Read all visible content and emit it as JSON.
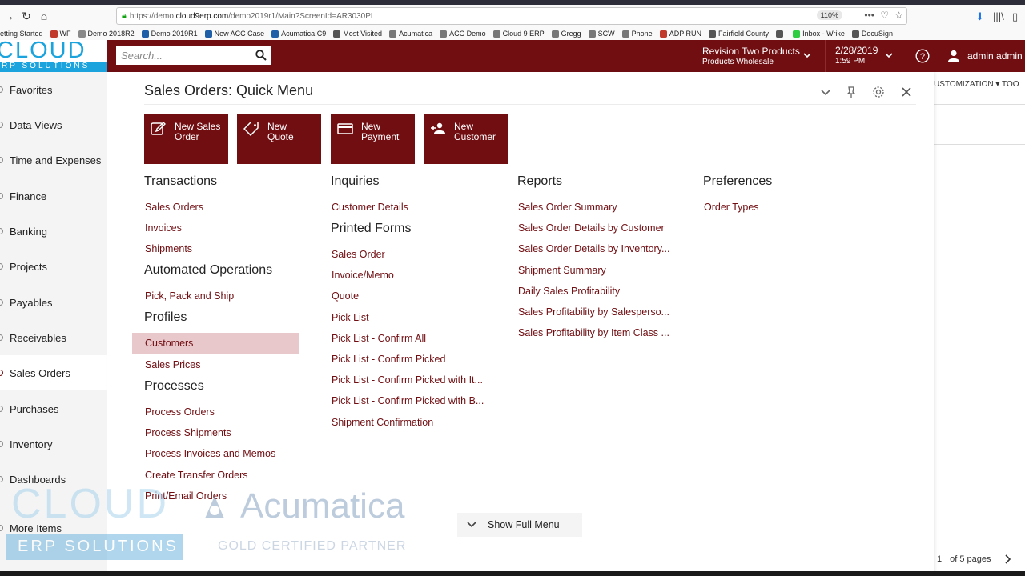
{
  "browser": {
    "url_prefix": "https://demo.",
    "url_domain": "cloud9erp.com",
    "url_path": "/demo2019r1/Main?ScreenId=AR3030PL",
    "zoom": "110%",
    "bookmarks": [
      {
        "label": "etting Started",
        "color": "#ffffff"
      },
      {
        "label": "WF",
        "color": "#c0392b"
      },
      {
        "label": "Demo 2018R2",
        "color": "#888888"
      },
      {
        "label": "Demo 2019R1",
        "color": "#1f5fa8"
      },
      {
        "label": "New ACC Case",
        "color": "#1f5fa8"
      },
      {
        "label": "Acumatica C9",
        "color": "#1f5fa8"
      },
      {
        "label": "Most Visited",
        "color": "#555555"
      },
      {
        "label": "Acumatica",
        "color": "#777777"
      },
      {
        "label": "ACC Demo",
        "color": "#777777"
      },
      {
        "label": "Cloud 9 ERP",
        "color": "#777777"
      },
      {
        "label": "Gregg",
        "color": "#777777"
      },
      {
        "label": "SCW",
        "color": "#777777"
      },
      {
        "label": "Phone",
        "color": "#777777"
      },
      {
        "label": "ADP RUN",
        "color": "#c0392b"
      },
      {
        "label": "Fairfield County",
        "color": "#555555"
      },
      {
        "label": "",
        "color": "#555555"
      },
      {
        "label": "Inbox - Wrike",
        "color": "#2ecc40"
      },
      {
        "label": "DocuSign",
        "color": "#555555"
      }
    ]
  },
  "header": {
    "logo_top": "CLOUD",
    "logo_bottom": "RP SOLUTIONS",
    "search_placeholder": "Search...",
    "branch_line1": "Revision Two Products",
    "branch_line2": "Products Wholesale",
    "date": "2/28/2019",
    "time": "1:59 PM",
    "user": "admin admin",
    "accent": "#700e12"
  },
  "sidebar": {
    "items": [
      "Favorites",
      "Data Views",
      "Time and Expenses",
      "Finance",
      "Banking",
      "Projects",
      "Payables",
      "Receivables",
      "Sales Orders",
      "Purchases",
      "Inventory",
      "Dashboards",
      "More Items"
    ],
    "active": "Sales Orders"
  },
  "quick_menu": {
    "title": "Sales Orders: Quick Menu",
    "buttons": [
      {
        "line1": "New Sales",
        "line2": "Order",
        "icon": "edit-icon"
      },
      {
        "line1": "New",
        "line2": "Quote",
        "icon": "tag-icon"
      },
      {
        "line1": "New",
        "line2": "Payment",
        "icon": "card-icon"
      },
      {
        "line1": "New",
        "line2": "Customer",
        "icon": "add-person-icon"
      }
    ],
    "transactions": {
      "heading": "Transactions",
      "links": [
        "Sales Orders",
        "Invoices",
        "Shipments"
      ]
    },
    "automated": {
      "heading": "Automated Operations",
      "links": [
        "Pick, Pack and Ship"
      ]
    },
    "profiles": {
      "heading": "Profiles",
      "links": [
        "Customers",
        "Sales Prices"
      ]
    },
    "processes": {
      "heading": "Processes",
      "links": [
        "Process Orders",
        "Process Shipments",
        "Process Invoices and Memos",
        "Create Transfer Orders",
        "Print/Email Orders"
      ]
    },
    "inquiries": {
      "heading": "Inquiries",
      "links": [
        "Customer Details"
      ]
    },
    "printed_forms": {
      "heading": "Printed Forms",
      "links": [
        "Sales Order",
        "Invoice/Memo",
        "Quote",
        "Pick List",
        "Pick List - Confirm All",
        "Pick List - Confirm Picked",
        "Pick List - Confirm Picked with It...",
        "Pick List - Confirm Picked with B...",
        "Shipment Confirmation"
      ]
    },
    "reports": {
      "heading": "Reports",
      "links": [
        "Sales Order Summary",
        "Sales Order Details by Customer",
        "Sales Order Details by Inventory...",
        "Shipment Summary",
        "Daily Sales Profitability",
        "Sales Profitability by Salesperso...",
        "Sales Profitability by Item Class ..."
      ]
    },
    "preferences": {
      "heading": "Preferences",
      "links": [
        "Order Types"
      ]
    },
    "show_full_menu": "Show Full Menu"
  },
  "background": {
    "tabs": "USTOMIZATION ▾    TOO",
    "pager_current": "1",
    "pager_text": "of 5 pages"
  },
  "watermark": {
    "cloud_top": "CLOUD",
    "cloud_bottom": "ERP SOLUTIONS",
    "acumatica": "Acumatica",
    "acumatica_sub": "GOLD CERTIFIED PARTNER"
  }
}
